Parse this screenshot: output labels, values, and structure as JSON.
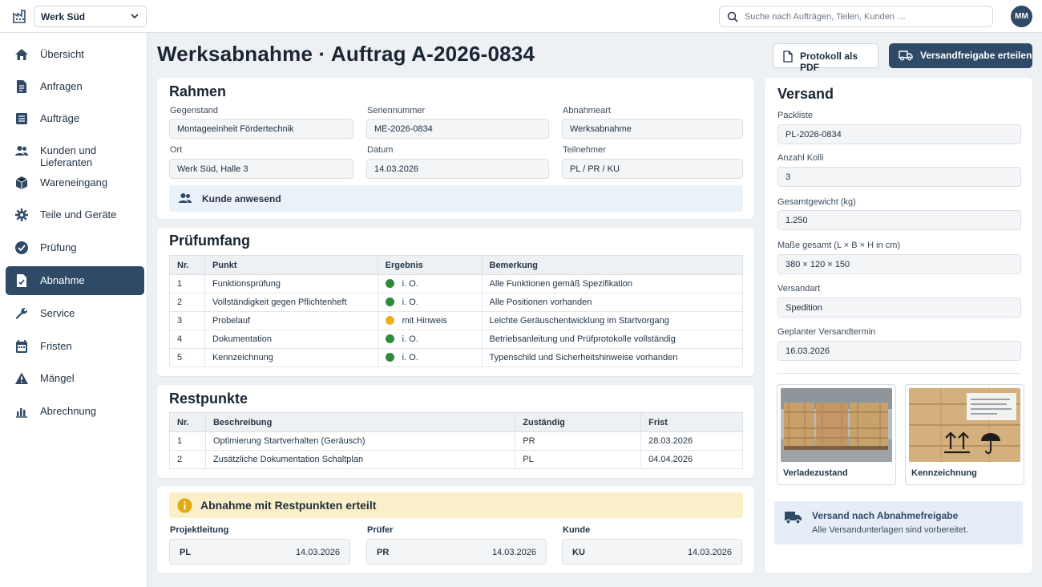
{
  "topbar": {
    "plant": "Werk Süd",
    "search_placeholder": "Suche nach Aufträgen, Teilen, Kunden …",
    "user_initials": "MM"
  },
  "sidebar": {
    "items": [
      {
        "label": "Übersicht",
        "icon": "home-icon"
      },
      {
        "label": "Anfragen",
        "icon": "document-icon"
      },
      {
        "label": "Aufträge",
        "icon": "list-icon"
      },
      {
        "label": "Kunden und Lieferanten",
        "icon": "people-icon"
      },
      {
        "label": "Wareneingang",
        "icon": "box-icon"
      },
      {
        "label": "Teile und Geräte",
        "icon": "gear-icon"
      },
      {
        "label": "Prüfung",
        "icon": "check-circle-icon"
      },
      {
        "label": "Abnahme",
        "icon": "approval-document-icon",
        "active": true
      },
      {
        "label": "Service",
        "icon": "wrench-icon"
      },
      {
        "label": "Fristen",
        "icon": "calendar-icon"
      },
      {
        "label": "Mängel",
        "icon": "warning-icon"
      },
      {
        "label": "Abrechnung",
        "icon": "bar-chart-icon"
      }
    ]
  },
  "header": {
    "title": "Werksabnahme · Auftrag A-2026-0834",
    "pdf_button": "Protokoll als PDF",
    "ship_button": "Versandfreigabe erteilen"
  },
  "rahmen": {
    "title": "Rahmen",
    "fields": {
      "gegenstand": {
        "label": "Gegenstand",
        "value": "Montageeinheit Fördertechnik"
      },
      "seriennummer": {
        "label": "Seriennummer",
        "value": "ME-2026-0834"
      },
      "abnahmeart": {
        "label": "Abnahmeart",
        "value": "Werksabnahme"
      },
      "ort": {
        "label": "Ort",
        "value": "Werk Süd, Halle 3"
      },
      "datum": {
        "label": "Datum",
        "value": "14.03.2026"
      },
      "teilnehmer": {
        "label": "Teilnehmer",
        "value": "PL / PR / KU"
      }
    },
    "presence": "Kunde anwesend"
  },
  "pruefumfang": {
    "title": "Prüfumfang",
    "columns": [
      "Nr.",
      "Punkt",
      "Ergebnis",
      "Bemerkung"
    ],
    "rows": [
      {
        "nr": "1",
        "punkt": "Funktionsprüfung",
        "ergebnis": "i. O.",
        "status_color": "#2e8b3d",
        "bemerkung": "Alle Funktionen gemäß Spezifikation"
      },
      {
        "nr": "2",
        "punkt": "Vollständigkeit gegen Pflichtenheft",
        "ergebnis": "i. O.",
        "status_color": "#2e8b3d",
        "bemerkung": "Alle Positionen vorhanden"
      },
      {
        "nr": "3",
        "punkt": "Probelauf",
        "ergebnis": "mit Hinweis",
        "status_color": "#e8b21c",
        "bemerkung": "Leichte Geräuschentwicklung im Startvorgang"
      },
      {
        "nr": "4",
        "punkt": "Dokumentation",
        "ergebnis": "i. O.",
        "status_color": "#2e8b3d",
        "bemerkung": "Betriebsanleitung und Prüfprotokolle vollständig"
      },
      {
        "nr": "5",
        "punkt": "Kennzeichnung",
        "ergebnis": "i. O.",
        "status_color": "#2e8b3d",
        "bemerkung": "Typenschild und Sicherheitshinweise vorhanden"
      }
    ]
  },
  "restpunkte": {
    "title": "Restpunkte",
    "columns": [
      "Nr.",
      "Beschreibung",
      "Zuständig",
      "Frist"
    ],
    "rows": [
      {
        "nr": "1",
        "beschreibung": "Optimierung Startverhalten (Geräusch)",
        "zustaendig": "PR",
        "frist": "28.03.2026"
      },
      {
        "nr": "2",
        "beschreibung": "Zusätzliche Dokumentation Schaltplan",
        "zustaendig": "PL",
        "frist": "04.04.2026"
      }
    ]
  },
  "abnahme": {
    "status": "Abnahme mit Restpunkten erteilt",
    "signatures": [
      {
        "label": "Projektleitung",
        "who": "PL",
        "date": "14.03.2026"
      },
      {
        "label": "Prüfer",
        "who": "PR",
        "date": "14.03.2026"
      },
      {
        "label": "Kunde",
        "who": "KU",
        "date": "14.03.2026"
      }
    ]
  },
  "versand": {
    "title": "Versand",
    "fields": [
      {
        "label": "Packliste",
        "value": "PL-2026-0834"
      },
      {
        "label": "Anzahl Kolli",
        "value": "3"
      },
      {
        "label": "Gesamtgewicht (kg)",
        "value": "1.250"
      },
      {
        "label": "Maße gesamt (L × B × H in cm)",
        "value": "380 × 120 × 150"
      },
      {
        "label": "Versandart",
        "value": "Spedition"
      },
      {
        "label": "Geplanter Versandtermin",
        "value": "16.03.2026"
      }
    ],
    "photos": [
      {
        "caption": "Verladezustand"
      },
      {
        "caption": "Kennzeichnung"
      }
    ],
    "note_title": "Versand nach Abnahmefreigabe",
    "note_text": "Alle Versandunterlagen sind vorbereitet."
  },
  "colors": {
    "accent": "#2f4a66",
    "ok": "#2e8b3d",
    "warning": "#e8b21c"
  }
}
